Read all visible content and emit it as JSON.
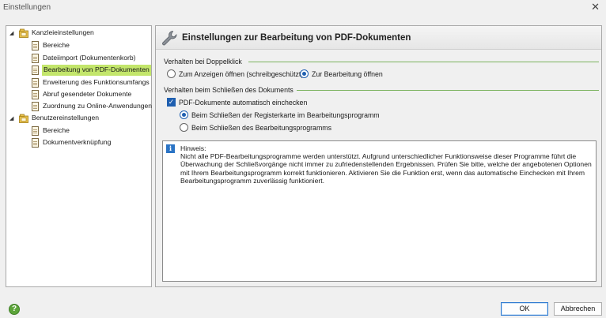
{
  "window": {
    "title": "Einstellungen"
  },
  "tree": {
    "groups": [
      {
        "label": "Kanzleieinstellungen",
        "items": [
          "Bereiche",
          "Dateiimport (Dokumentenkorb)",
          "Bearbeitung von PDF-Dokumenten",
          "Erweiterung des Funktionsumfangs",
          "Abruf gesendeter Dokumente",
          "Zuordnung zu Online-Anwendungen"
        ]
      },
      {
        "label": "Benutzereinstellungen",
        "items": [
          "Bereiche",
          "Dokumentverknüpfung"
        ]
      }
    ],
    "selected_item": "Bearbeitung von PDF-Dokumenten"
  },
  "panel": {
    "title": "Einstellungen zur Bearbeitung von PDF-Dokumenten",
    "doubleclick": {
      "label": "Verhalten bei Doppelklick",
      "option_view": "Zum Anzeigen öffnen (schreibgeschützt)",
      "option_edit": "Zur Bearbeitung öffnen",
      "selected": "Zur Bearbeitung öffnen"
    },
    "close_doc": {
      "label": "Verhalten beim Schließen des Dokuments",
      "auto_checkin_label": "PDF-Dokumente automatisch einchecken",
      "auto_checkin_checked": true,
      "option_tab": "Beim Schließen der Registerkarte im Bearbeitungsprogramm",
      "option_program": "Beim Schließen des Bearbeitungsprogramms",
      "selected": "Beim Schließen der Registerkarte im Bearbeitungsprogramm"
    },
    "hint": {
      "title": "Hinweis:",
      "text": "Nicht alle PDF-Bearbeitungsprogramme werden unterstützt. Aufgrund unterschiedlicher Funktionsweise dieser Programme führt die Überwachung der Schließvorgänge nicht immer zu zufriedenstellenden Ergebnissen. Prüfen Sie bitte, welche der angebotenen Optionen mit Ihrem Bearbeitungsprogramm korrekt funktionieren. Aktivieren Sie die Funktion erst, wenn das automatische Einchecken mit Ihrem Bearbeitungsprogramm zuverlässig funktioniert."
    }
  },
  "footer": {
    "ok_label": "OK",
    "cancel_label": "Abbrechen",
    "help_label": "?"
  },
  "colors": {
    "selection": "#c3e66b",
    "group_line": "#7cb35f",
    "accent": "#1f5fb0"
  },
  "icons": {
    "close": "close-icon",
    "tree_group": "folder-icon",
    "tree_item": "page-icon",
    "header": "wrench-icon",
    "hint": "info-icon",
    "help": "help-icon"
  }
}
